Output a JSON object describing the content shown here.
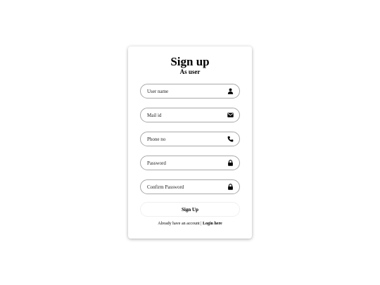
{
  "form": {
    "title": "Sign up",
    "subtitle": "As user",
    "fields": [
      {
        "placeholder": "User name",
        "icon": "user-icon"
      },
      {
        "placeholder": "Mail id",
        "icon": "envelope-icon"
      },
      {
        "placeholder": "Phone no",
        "icon": "phone-icon"
      },
      {
        "placeholder": "Password",
        "icon": "lock-icon"
      },
      {
        "placeholder": "Confirm Password",
        "icon": "lock-icon"
      }
    ],
    "submit_label": "Sign Up",
    "footer_text": "Already have an account |",
    "footer_link": "Login here"
  },
  "colors": {
    "background": "#ffffff",
    "text": "#000000",
    "field_border": "#a9a9a9"
  }
}
